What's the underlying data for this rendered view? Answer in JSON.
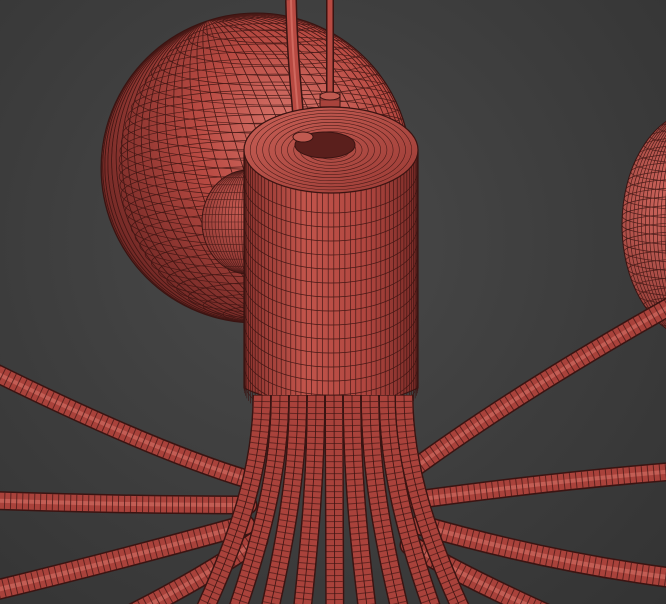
{
  "viewport": {
    "background_color": "#3c3c3c",
    "render_mode": "wireframe-over-shaded"
  },
  "model": {
    "material_color": "#b3463f",
    "highlight_color": "#cf6a60",
    "shadow_color": "#6e2a26",
    "wire_color": "#3a1412",
    "parts": [
      "hanging-cables",
      "large-sphere-left",
      "sphere-right-partial",
      "cylindrical-canopy",
      "radiating-tube-arms"
    ]
  }
}
